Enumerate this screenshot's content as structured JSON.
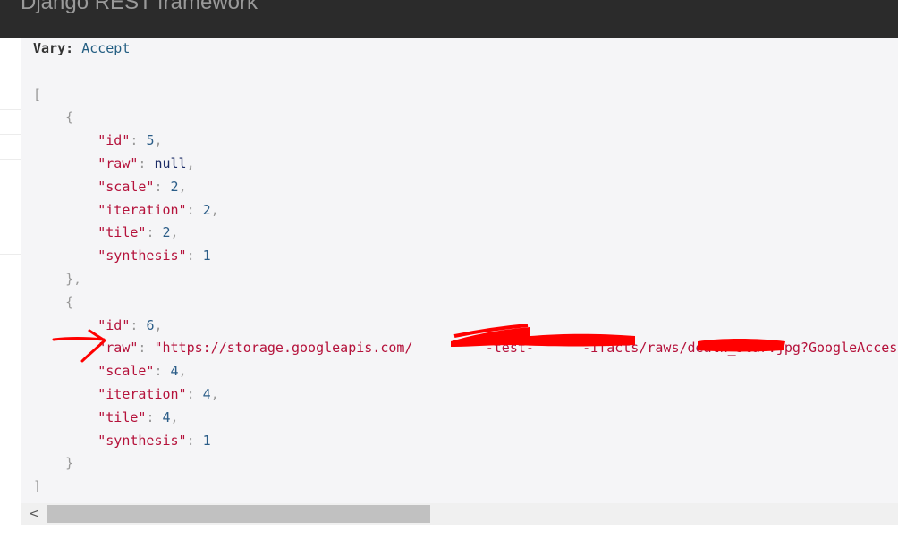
{
  "navbar": {
    "brand": "Django REST framework"
  },
  "response": {
    "header_name": "Vary:",
    "header_value": "Accept",
    "lines": {
      "open_array": "[",
      "open_obj1": "{",
      "obj1_id_key": "\"id\"",
      "obj1_id_val": "5",
      "obj1_raw_key": "\"raw\"",
      "obj1_raw_val": "null",
      "obj1_scale_key": "\"scale\"",
      "obj1_scale_val": "2",
      "obj1_iteration_key": "\"iteration\"",
      "obj1_iteration_val": "2",
      "obj1_tile_key": "\"tile\"",
      "obj1_tile_val": "2",
      "obj1_synthesis_key": "\"synthesis\"",
      "obj1_synthesis_val": "1",
      "close_obj1": "},",
      "open_obj2": "{",
      "obj2_id_key": "\"id\"",
      "obj2_id_val": "6",
      "obj2_raw_key": "\"raw\"",
      "obj2_raw_val": "\"https://storage.googleapis.com/         -test-      -ifacts/raws/death_star.jpg?GoogleAccessId",
      "obj2_scale_key": "\"scale\"",
      "obj2_scale_val": "4",
      "obj2_iteration_key": "\"iteration\"",
      "obj2_iteration_val": "4",
      "obj2_tile_key": "\"tile\"",
      "obj2_tile_val": "4",
      "obj2_synthesis_key": "\"synthesis\"",
      "obj2_synthesis_val": "1",
      "close_obj2": "}",
      "close_array": "]"
    }
  },
  "scrollbar": {
    "left_arrow": "<"
  },
  "colors": {
    "navbar_bg": "#2b2b2b",
    "content_bg": "#f5f5f7",
    "string": "#b5123b",
    "number": "#2b5d88",
    "annotation": "#ff0000"
  },
  "icons": {
    "annotation": "red-arrow-icon",
    "scroll_left": "chevron-left-icon"
  }
}
